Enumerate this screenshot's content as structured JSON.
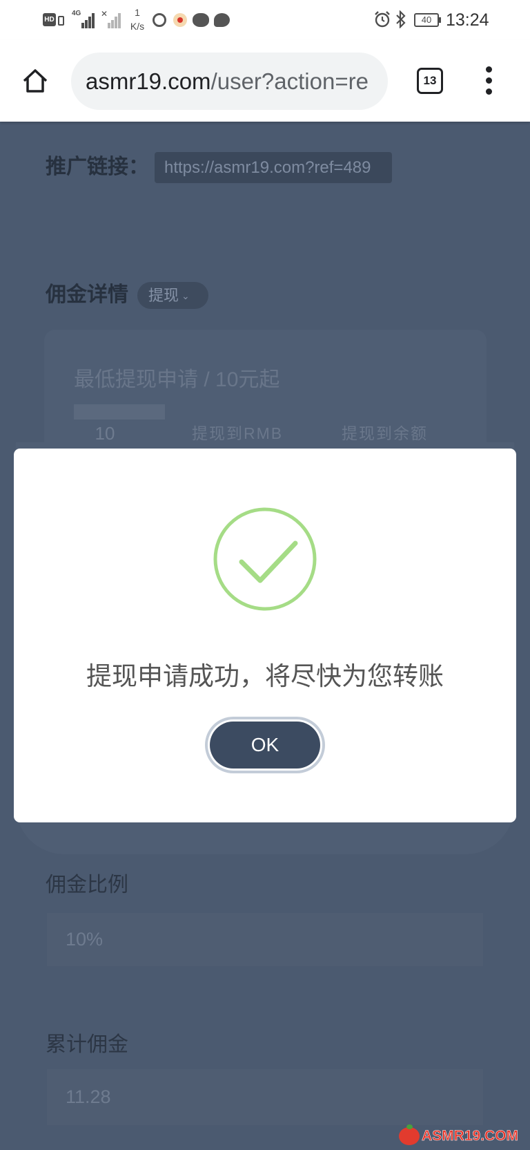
{
  "status_bar": {
    "hd": "HD",
    "network": "4G",
    "speed_value": "1",
    "speed_unit": "K/s",
    "battery": "40",
    "time": "13:24"
  },
  "browser": {
    "url_host": "asmr19.com",
    "url_path": "/user?action=re",
    "tab_count": "13"
  },
  "page": {
    "referral_label": "推广链接：",
    "referral_link": "https://asmr19.com?ref=489",
    "commission_title": "佣金详情",
    "commission_mode": "提现",
    "withdraw_hint": "最低提现申请 / 10元起",
    "withdraw_amount": "10",
    "withdraw_rmb": "提现到RMB",
    "withdraw_balance": "提现到余额",
    "rate_label": "佣金比例",
    "rate_value": "10%",
    "total_label": "累计佣金",
    "total_value": "11.28"
  },
  "dialog": {
    "icon": "success-check-icon",
    "message": "提现申请成功，将尽快为您转账",
    "ok_label": "OK"
  },
  "watermark": "ASMR19.COM",
  "colors": {
    "overlay_bg": "#4b5a70",
    "dialog_bg": "#ffffff",
    "success_green": "#a5dc86",
    "ok_button": "#3c4b61",
    "watermark_red": "#e8352a"
  }
}
